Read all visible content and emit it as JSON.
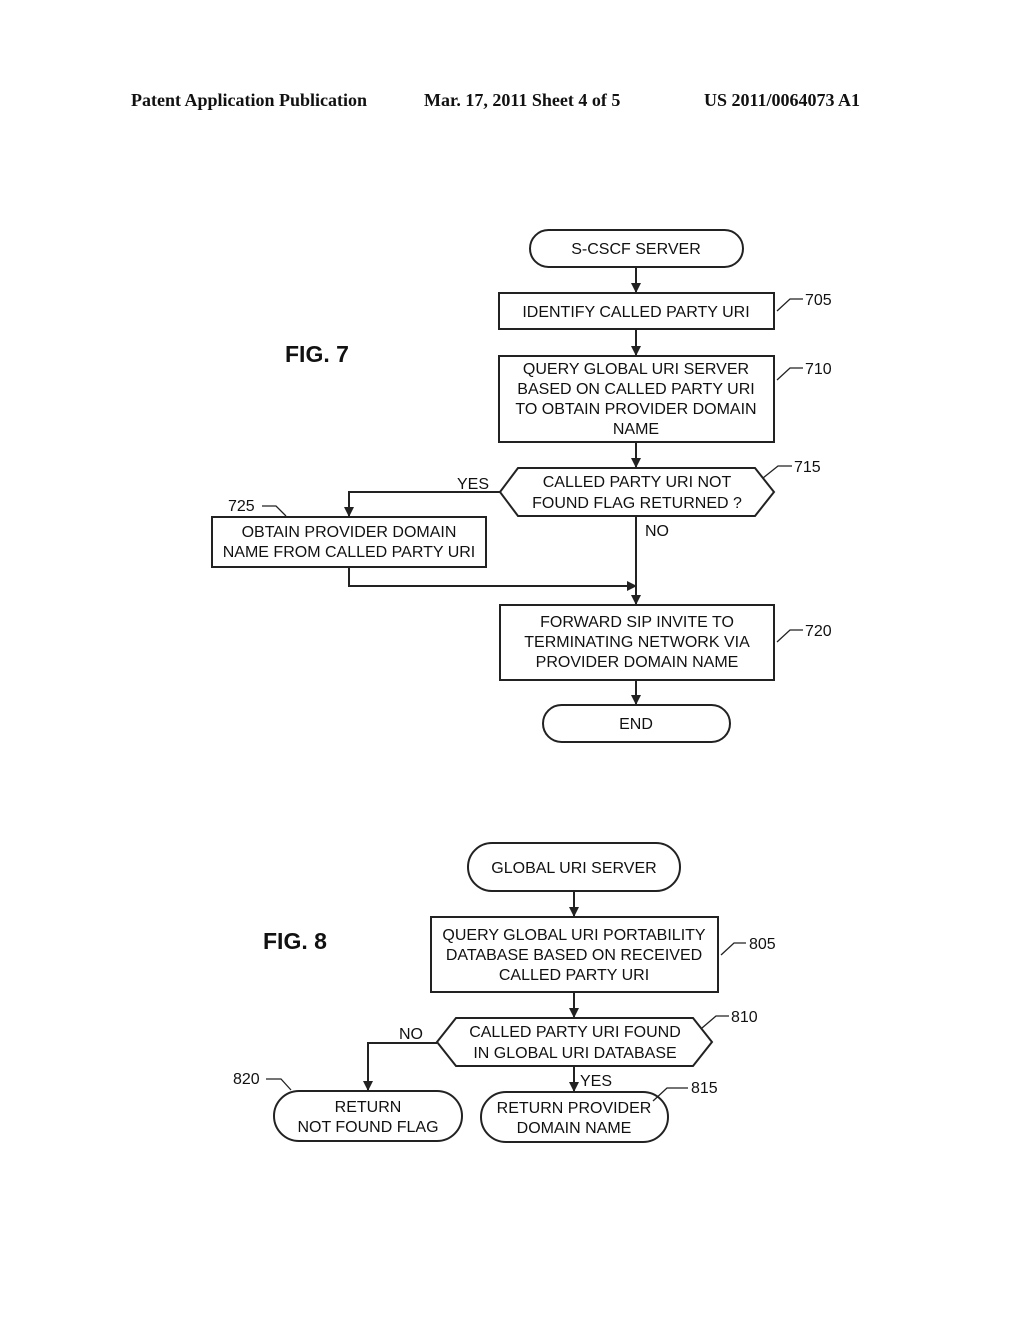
{
  "header": {
    "left": "Patent Application Publication",
    "center": "Mar. 17, 2011  Sheet 4 of 5",
    "right": "US 2011/0064073 A1"
  },
  "fig7": {
    "title": "FIG. 7",
    "start": "S-CSCF SERVER",
    "step705": {
      "ref": "705",
      "lines": [
        "IDENTIFY CALLED PARTY URI"
      ]
    },
    "step710": {
      "ref": "710",
      "lines": [
        "QUERY GLOBAL URI SERVER",
        "BASED ON CALLED PARTY URI",
        "TO OBTAIN PROVIDER DOMAIN",
        "NAME"
      ]
    },
    "decision715": {
      "ref": "715",
      "lines": [
        "CALLED PARTY URI NOT",
        "FOUND FLAG RETURNED ?"
      ],
      "yes": "YES",
      "no": "NO"
    },
    "step725": {
      "ref": "725",
      "lines": [
        "OBTAIN PROVIDER DOMAIN",
        "NAME FROM CALLED PARTY URI"
      ]
    },
    "step720": {
      "ref": "720",
      "lines": [
        "FORWARD SIP INVITE TO",
        "TERMINATING NETWORK VIA",
        "PROVIDER DOMAIN NAME"
      ]
    },
    "end": "END"
  },
  "fig8": {
    "title": "FIG. 8",
    "start": "GLOBAL URI SERVER",
    "step805": {
      "ref": "805",
      "lines": [
        "QUERY GLOBAL URI PORTABILITY",
        "DATABASE BASED ON RECEIVED",
        "CALLED PARTY URI"
      ]
    },
    "decision810": {
      "ref": "810",
      "lines": [
        "CALLED PARTY URI FOUND",
        "IN GLOBAL URI DATABASE"
      ],
      "yes": "YES",
      "no": "NO"
    },
    "end815": {
      "ref": "815",
      "lines": [
        "RETURN PROVIDER",
        "DOMAIN NAME"
      ]
    },
    "end820": {
      "ref": "820",
      "lines": [
        "RETURN",
        "NOT FOUND FLAG"
      ]
    }
  }
}
